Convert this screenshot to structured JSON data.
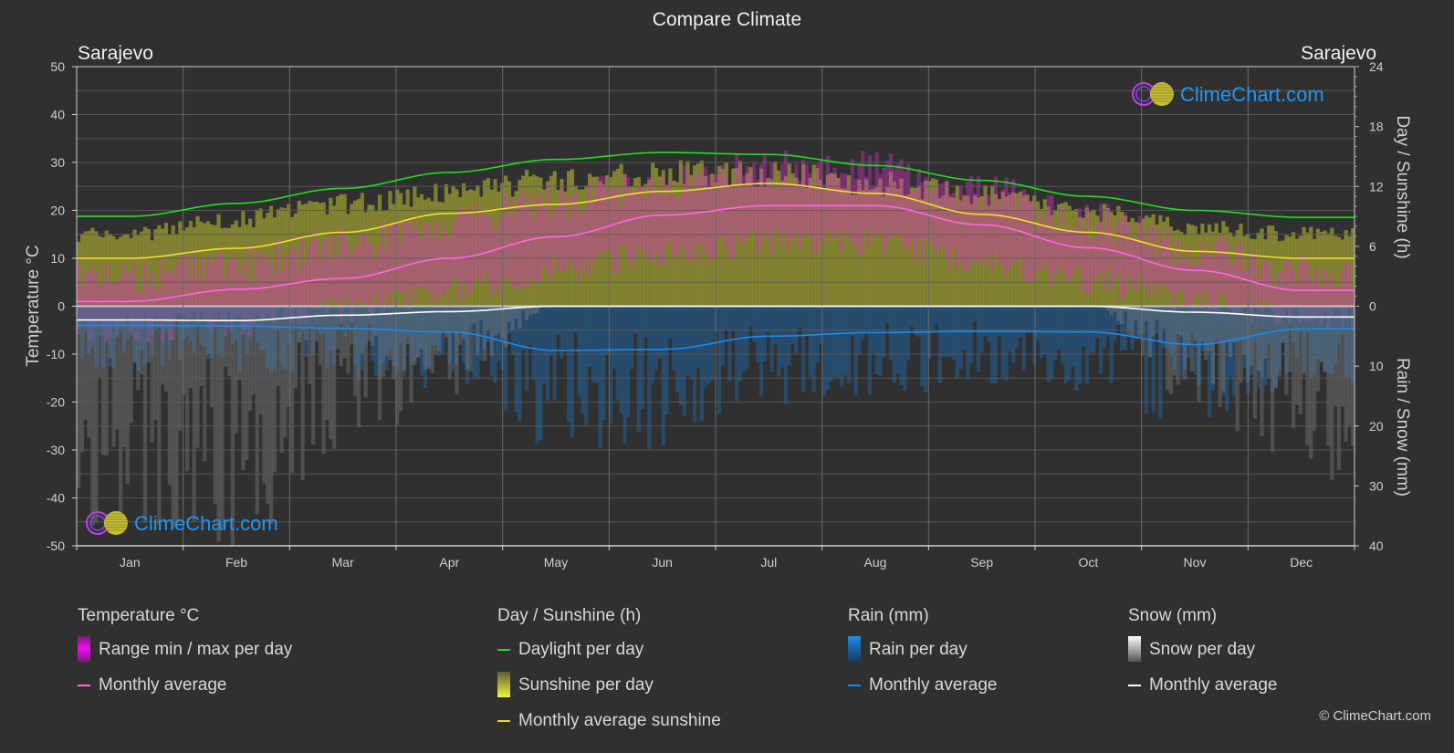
{
  "title": "Compare Climate",
  "location_left": "Sarajevo",
  "location_right": "Sarajevo",
  "watermark": "ClimeChart.com",
  "copyright": "© ClimeChart.com",
  "colors": {
    "background": "#303030",
    "grid": "#5a5a5a",
    "temp_range": "#e030d0",
    "temp_avg": "#ff66e6",
    "daylight": "#22dd22",
    "sunshine_fill": "#9a9a30",
    "sunshine_avg": "#f0e030",
    "rain_fill": "#1e6ab0",
    "rain_avg": "#1a8cf0",
    "snow_fill": "#8a8a8a",
    "snow_avg": "#ffffff",
    "watermark_text": "#2196f3"
  },
  "legend": {
    "temperature": {
      "heading": "Temperature °C",
      "items": [
        "Range min / max per day",
        "Monthly average"
      ]
    },
    "sunshine": {
      "heading": "Day / Sunshine (h)",
      "items": [
        "Daylight per day",
        "Sunshine per day",
        "Monthly average sunshine"
      ]
    },
    "rain": {
      "heading": "Rain (mm)",
      "items": [
        "Rain per day",
        "Monthly average"
      ]
    },
    "snow": {
      "heading": "Snow (mm)",
      "items": [
        "Snow per day",
        "Monthly average"
      ]
    }
  },
  "chart_data": {
    "type": "line",
    "title": "Compare Climate",
    "categories": [
      "Jan",
      "Feb",
      "Mar",
      "Apr",
      "May",
      "Jun",
      "Jul",
      "Aug",
      "Sep",
      "Oct",
      "Nov",
      "Dec"
    ],
    "grid": true,
    "axes": {
      "left": {
        "label": "Temperature °C",
        "range": [
          -50,
          50
        ],
        "ticks": [
          50,
          40,
          30,
          20,
          10,
          0,
          -10,
          -20,
          -30,
          -40,
          -50
        ]
      },
      "right_top": {
        "label": "Day / Sunshine (h)",
        "range": [
          0,
          24
        ],
        "ticks": [
          24,
          18,
          12,
          6,
          0
        ]
      },
      "right_bottom": {
        "label": "Rain / Snow (mm)",
        "range": [
          0,
          40
        ],
        "ticks": [
          0,
          10,
          20,
          30,
          40
        ],
        "inverted": true
      }
    },
    "series": [
      {
        "name": "Temperature monthly average",
        "axis": "left",
        "unit": "°C",
        "values": [
          1.0,
          3.5,
          5.8,
          10.0,
          14.5,
          19.0,
          21.0,
          21.0,
          17.0,
          12.2,
          7.5,
          3.3
        ]
      },
      {
        "name": "Temperature daily max (approx.)",
        "axis": "left",
        "unit": "°C",
        "values": [
          5,
          8,
          12,
          16,
          21,
          25,
          28,
          28,
          23,
          17,
          11,
          6
        ]
      },
      {
        "name": "Temperature daily min (approx.)",
        "axis": "left",
        "unit": "°C",
        "values": [
          -4,
          -3,
          0,
          4,
          8,
          12,
          14,
          14,
          10,
          6,
          2,
          -2
        ]
      },
      {
        "name": "Daylight per day",
        "axis": "right_top",
        "unit": "h",
        "values": [
          9.0,
          10.3,
          11.8,
          13.4,
          14.7,
          15.4,
          15.2,
          14.1,
          12.6,
          11.0,
          9.6,
          8.9
        ]
      },
      {
        "name": "Sunshine per day (approx. top)",
        "axis": "right_top",
        "unit": "h",
        "values": [
          7.6,
          9.2,
          10.8,
          12.0,
          13.3,
          14.0,
          14.0,
          13.0,
          11.6,
          10.0,
          8.3,
          7.6
        ]
      },
      {
        "name": "Monthly average sunshine",
        "axis": "right_top",
        "unit": "h",
        "values": [
          4.8,
          5.8,
          7.4,
          9.3,
          10.2,
          11.5,
          12.3,
          11.3,
          9.2,
          7.4,
          5.5,
          4.8
        ]
      },
      {
        "name": "Rain monthly average",
        "axis": "right_bottom",
        "unit": "mm",
        "values": [
          3.2,
          3.3,
          3.7,
          4.3,
          7.4,
          7.2,
          5.0,
          4.4,
          4.2,
          4.3,
          6.4,
          3.8
        ]
      },
      {
        "name": "Snow monthly average",
        "axis": "right_bottom",
        "unit": "mm",
        "values": [
          2.3,
          2.4,
          1.5,
          0.9,
          0.0,
          0.0,
          0.0,
          0.0,
          0.0,
          0.0,
          1.0,
          1.8
        ]
      }
    ]
  }
}
